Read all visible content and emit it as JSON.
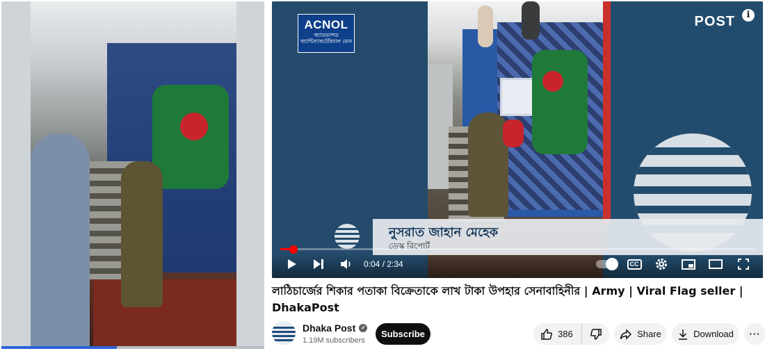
{
  "overlay": {
    "acnol_brand": "ACNOL",
    "acnol_sub": "অ্যাডভান্সড অ্যান্টিব্যাকটেরিয়াল মোন",
    "post_logo": "POST",
    "lower_third_name": "নুসরাত জাহান মেহেক",
    "lower_third_role": "ডেস্ক রিপোর্ট"
  },
  "player": {
    "current_time": "0:04",
    "duration": "2:34",
    "time_display": "0:04 / 2:34",
    "progress_fraction": 0.026,
    "cc_label": "CC"
  },
  "video": {
    "title": "লাঠিচার্জের শিকার পতাকা বিক্রেতাকে লাখ টাকা উপহার সেনাবাহিনীর | Army | Viral Flag seller | DhakaPost"
  },
  "channel": {
    "name": "Dhaka Post",
    "subscribers": "1.19M subscribers",
    "subscribe_label": "Subscribe"
  },
  "actions": {
    "like_count": "386",
    "share_label": "Share",
    "download_label": "Download",
    "more_label": "···"
  },
  "thumbnail": {
    "progress_fraction": 0.44
  },
  "colors": {
    "youtube_red": "#ff0000",
    "player_blue": "#214a69",
    "subscribe_bg": "#0f0f0f"
  }
}
